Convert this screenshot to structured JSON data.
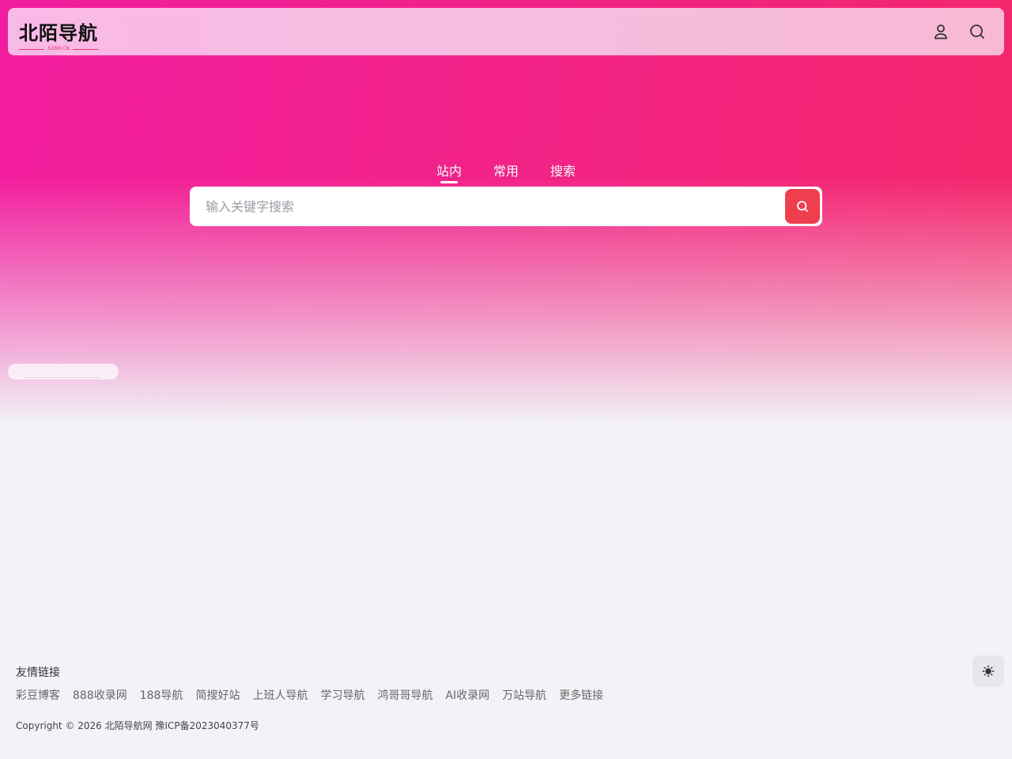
{
  "header": {
    "logo_text": "北陌导航",
    "logo_sub": "52BM.CN",
    "user_icon": "user-icon",
    "search_icon": "search-icon"
  },
  "search": {
    "tabs": [
      {
        "label": "站内",
        "active": true
      },
      {
        "label": "常用",
        "active": false
      },
      {
        "label": "搜索",
        "active": false
      }
    ],
    "placeholder": "输入关键字搜索",
    "value": "",
    "button_icon": "search-icon",
    "button_color": "#ef3f4f"
  },
  "footer": {
    "title": "友情链接",
    "links": [
      "彩豆博客",
      "888收录网",
      "188导航",
      "简搜好站",
      "上班人导航",
      "学习导航",
      "鸿哥哥导航",
      "AI收录网",
      "万站导航",
      "更多链接"
    ],
    "copyright": "Copyright © 2026 北陌导航网 豫ICP备2023040377号"
  },
  "theme_toggle": {
    "icon": "sun-icon"
  },
  "colors": {
    "accent": "#f2228a",
    "search_button": "#ef3f4f",
    "background": "#f2f3f7"
  }
}
